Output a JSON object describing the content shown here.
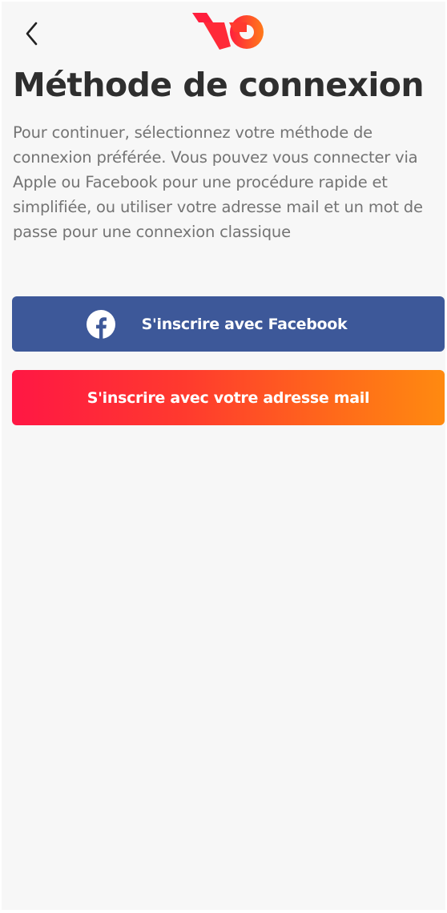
{
  "header": {
    "back_icon": "chevron-left-icon",
    "logo_icon": "brand-logo",
    "logo_colors": [
      "#ff1f3d",
      "#ff7a1a"
    ]
  },
  "title": "Méthode de connexion",
  "description": "Pour continuer, sélectionnez votre méthode de connexion préférée. Vous pouvez vous connecter via Apple ou Facebook pour une procédure rapide et simplifiée, ou utiliser votre adresse mail et un mot de passe pour une connexion classique",
  "buttons": {
    "facebook": {
      "label": "S'inscrire avec Facebook",
      "icon": "facebook-icon",
      "color": "#3d5899"
    },
    "email": {
      "label": "S'inscrire avec votre adresse mail",
      "gradient": [
        "#ff1744",
        "#ff8a10"
      ]
    }
  },
  "colors": {
    "background": "#f7f7f7",
    "title": "#2e2e2e",
    "text": "#747474"
  }
}
